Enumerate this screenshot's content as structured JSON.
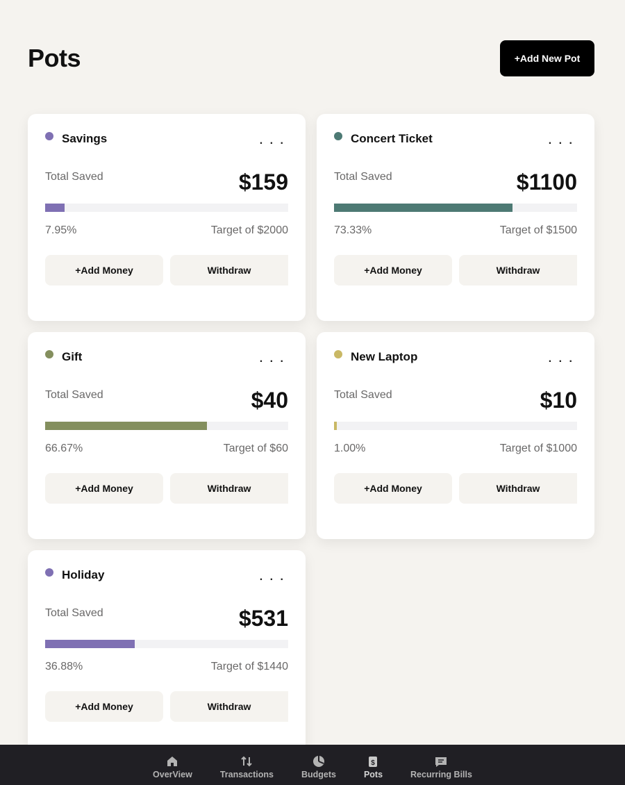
{
  "header": {
    "title": "Pots",
    "add_button": "+Add New Pot"
  },
  "pots": [
    {
      "name": "Savings",
      "color": "#7f70b3",
      "label": "Total Saved",
      "amount": "$159",
      "percent": "7.95%",
      "target": "Target of $2000",
      "progress": 0.0795,
      "add": "+Add Money",
      "withdraw": "Withdraw",
      "menu": ". . ."
    },
    {
      "name": "Concert Ticket",
      "color": "#4d7a74",
      "label": "Total Saved",
      "amount": "$1100",
      "percent": "73.33%",
      "target": "Target of $1500",
      "progress": 0.7333,
      "add": "+Add Money",
      "withdraw": "Withdraw",
      "menu": ". . ."
    },
    {
      "name": "Gift",
      "color": "#848f5e",
      "label": "Total Saved",
      "amount": "$40",
      "percent": "66.67%",
      "target": "Target of $60",
      "progress": 0.6667,
      "add": "+Add Money",
      "withdraw": "Withdraw",
      "menu": ". . ."
    },
    {
      "name": "New Laptop",
      "color": "#c9b865",
      "label": "Total Saved",
      "amount": "$10",
      "percent": "1.00%",
      "target": "Target of $1000",
      "progress": 0.01,
      "add": "+Add Money",
      "withdraw": "Withdraw",
      "menu": ". . ."
    },
    {
      "name": "Holiday",
      "color": "#7f70b3",
      "label": "Total Saved",
      "amount": "$531",
      "percent": "36.88%",
      "target": "Target of $1440",
      "progress": 0.3688,
      "add": "+Add Money",
      "withdraw": "Withdraw",
      "menu": ". . ."
    }
  ],
  "nav": [
    {
      "label": "OverView",
      "icon": "home-icon"
    },
    {
      "label": "Transactions",
      "icon": "transactions-icon"
    },
    {
      "label": "Budgets",
      "icon": "budgets-icon"
    },
    {
      "label": "Pots",
      "icon": "pots-icon"
    },
    {
      "label": "Recurring Bills",
      "icon": "bills-icon"
    }
  ]
}
